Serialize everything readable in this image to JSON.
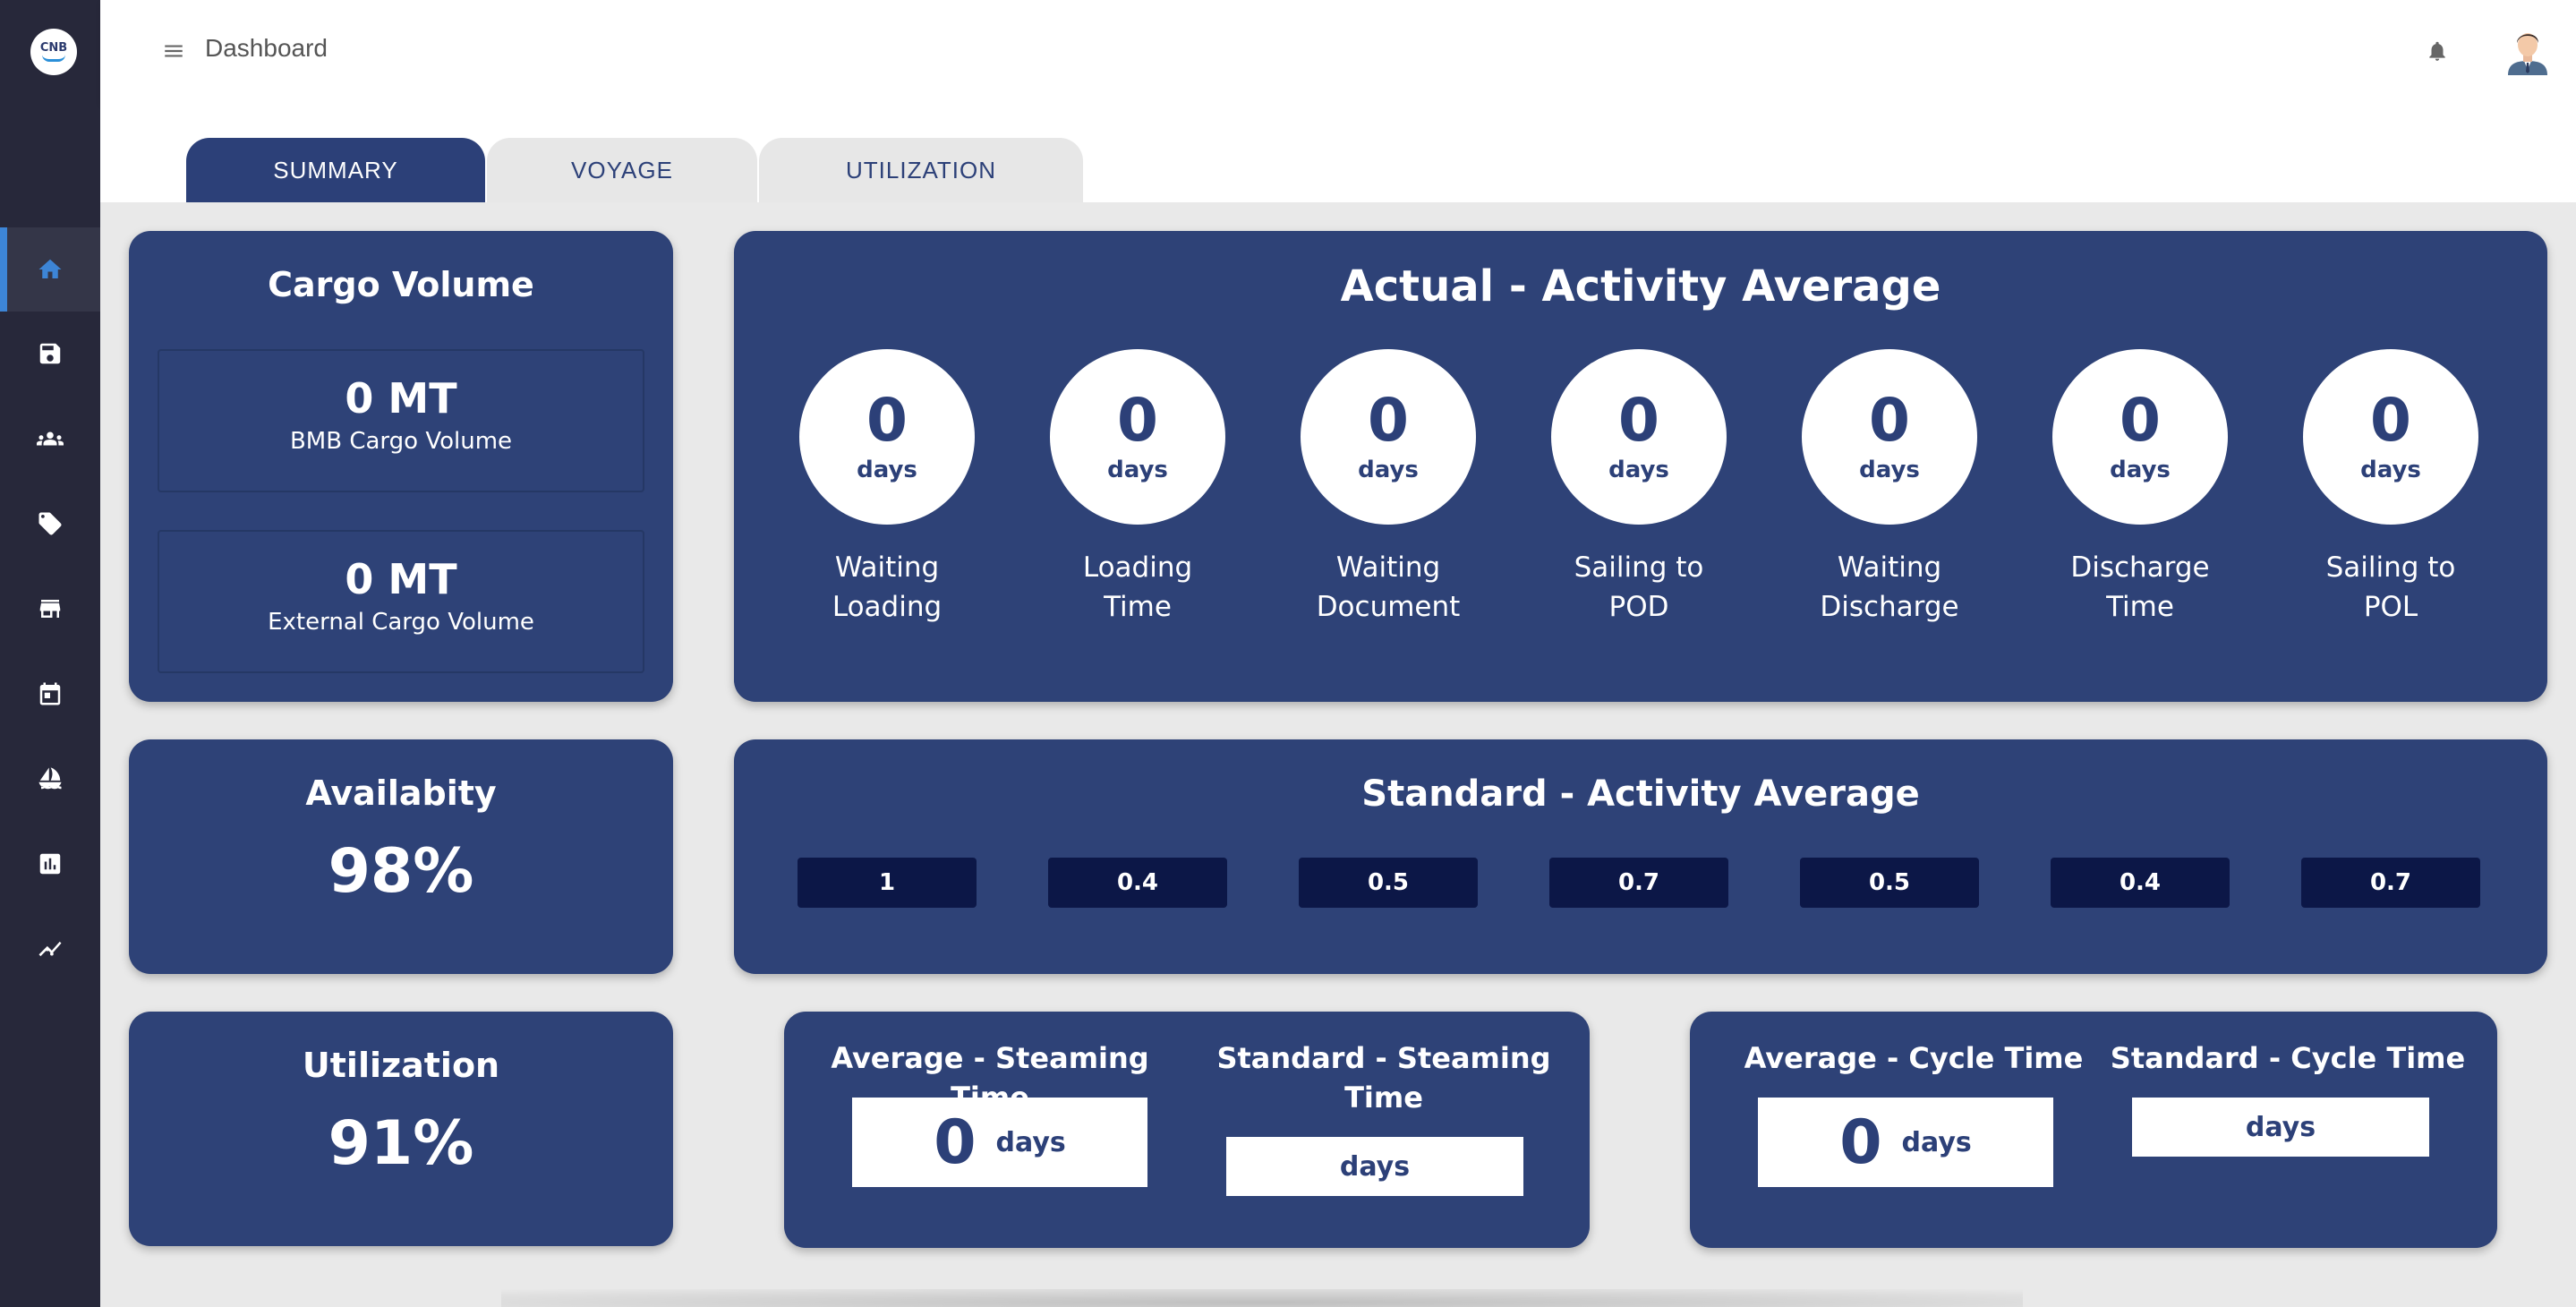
{
  "app": {
    "logo_text": "CNB"
  },
  "header": {
    "title": "Dashboard"
  },
  "tabs": [
    {
      "label": "SUMMARY",
      "active": true
    },
    {
      "label": "VOYAGE",
      "active": false
    },
    {
      "label": "UTILIZATION",
      "active": false
    }
  ],
  "sidebar": {
    "items": [
      {
        "icon": "home-icon",
        "active": true
      },
      {
        "icon": "save-icon",
        "active": false
      },
      {
        "icon": "people-icon",
        "active": false
      },
      {
        "icon": "tag-icon",
        "active": false
      },
      {
        "icon": "store-icon",
        "active": false
      },
      {
        "icon": "calendar-icon",
        "active": false
      },
      {
        "icon": "sailing-icon",
        "active": false
      },
      {
        "icon": "bar-chart-icon",
        "active": false
      },
      {
        "icon": "trending-icon",
        "active": false
      }
    ]
  },
  "cargo": {
    "title": "Cargo Volume",
    "bmb": {
      "value": "0 MT",
      "label": "BMB Cargo Volume"
    },
    "external": {
      "value": "0 MT",
      "label": "External Cargo Volume"
    }
  },
  "availability": {
    "title": "Availabity",
    "value": "98%"
  },
  "utilization": {
    "title": "Utilization",
    "value": "91%"
  },
  "actual": {
    "title": "Actual - Activity Average",
    "items": [
      {
        "value": "0",
        "unit": "days",
        "label_1": "Waiting",
        "label_2": "Loading"
      },
      {
        "value": "0",
        "unit": "days",
        "label_1": "Loading",
        "label_2": "Time"
      },
      {
        "value": "0",
        "unit": "days",
        "label_1": "Waiting",
        "label_2": "Document"
      },
      {
        "value": "0",
        "unit": "days",
        "label_1": "Sailing to",
        "label_2": "POD"
      },
      {
        "value": "0",
        "unit": "days",
        "label_1": "Waiting",
        "label_2": "Discharge"
      },
      {
        "value": "0",
        "unit": "days",
        "label_1": "Discharge",
        "label_2": "Time"
      },
      {
        "value": "0",
        "unit": "days",
        "label_1": "Sailing to",
        "label_2": "POL"
      }
    ]
  },
  "standard": {
    "title": "Standard - Activity Average",
    "values": [
      "1",
      "0.4",
      "0.5",
      "0.7",
      "0.5",
      "0.4",
      "0.7"
    ]
  },
  "steaming": {
    "avg_title": "Average - Steaming Time",
    "avg_value": "0",
    "avg_unit": "days",
    "std_title_1": "Standard - Steaming",
    "std_title_2": "Time",
    "std_unit": "days"
  },
  "cycle": {
    "avg_title": "Average - Cycle Time",
    "avg_value": "0",
    "avg_unit": "days",
    "std_title": "Standard - Cycle Time",
    "std_unit": "days"
  },
  "colors": {
    "sidebar_bg": "#27283a",
    "accent": "#3d85d6",
    "card_bg": "#2e4277",
    "chip_bg": "#0c1747"
  }
}
